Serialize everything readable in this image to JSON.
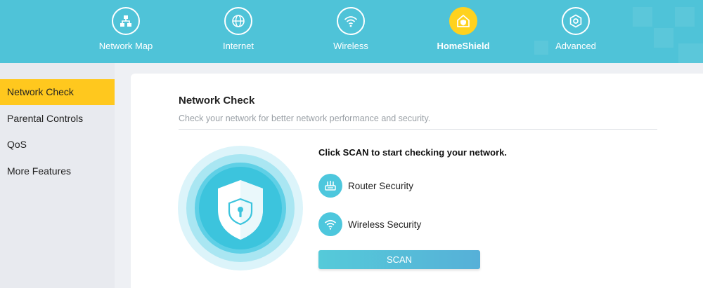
{
  "colors": {
    "header_bg": "#4fc3d8",
    "active_accent": "#ffc81e",
    "icon_teal": "#4dc7dd"
  },
  "nav": {
    "items": [
      {
        "label": "Network Map",
        "icon": "network-map-icon"
      },
      {
        "label": "Internet",
        "icon": "globe-icon"
      },
      {
        "label": "Wireless",
        "icon": "wifi-icon"
      },
      {
        "label": "HomeShield",
        "icon": "homeshield-icon",
        "active": true
      },
      {
        "label": "Advanced",
        "icon": "gear-icon"
      }
    ]
  },
  "sidebar": {
    "items": [
      {
        "label": "Network Check",
        "active": true
      },
      {
        "label": "Parental Controls"
      },
      {
        "label": "QoS"
      },
      {
        "label": "More Features"
      }
    ]
  },
  "main": {
    "title": "Network Check",
    "subtitle": "Check your network for better network performance and security.",
    "scan_prompt": "Click SCAN to start checking your network.",
    "checks": [
      {
        "label": "Router Security",
        "icon": "router-icon"
      },
      {
        "label": "Wireless Security",
        "icon": "wifi-icon"
      }
    ],
    "scan_button": "SCAN",
    "shield_icon": "shield-lock-icon"
  }
}
